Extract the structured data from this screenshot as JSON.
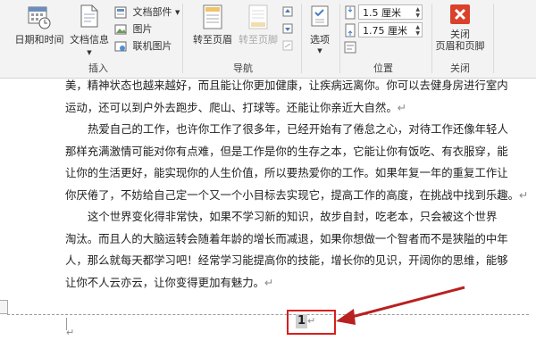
{
  "ribbon": {
    "insert_group": {
      "label": "插入",
      "date_time_label": "日期和时间",
      "doc_info_label": "文档信息",
      "doc_parts_label": "文档部件",
      "picture_label": "图片",
      "online_picture_label": "联机图片"
    },
    "nav_group": {
      "label": "导航",
      "goto_header_label": "转至页眉",
      "goto_footer_label": "转至页脚"
    },
    "options_group": {
      "options_label": "选项"
    },
    "position_group": {
      "label": "位置",
      "header_from_top": "1.5 厘米",
      "footer_from_bottom": "1.75 厘米"
    },
    "close_group": {
      "label": "关闭",
      "close_button_label_line1": "关闭",
      "close_button_label_line2": "页眉和页脚"
    }
  },
  "colors": {
    "accent_red": "#d61f1f",
    "close_icon_red": "#d9412b"
  },
  "document": {
    "lines": [
      "美，精神状态也越来越好，而且能让你更加健康，让疾病远离你。你可以去健身房进行室内",
      "运动，还可以到户外去跑步、爬山、打球等。还能让你亲近大自然。",
      "热爱自己的工作，也许你工作了很多年，已经开始有了倦怠之心，对待工作还像年轻人",
      "那样充满激情可能对你有点难，但是工作是你的生存之本，它能让你有饭吃、有衣服穿，能",
      "让你的生活更好，能实现你的人生价值，所以要热爱你的工作。如果年复一年的重复工作让",
      "你厌倦了，不妨给自己定一个又一个小目标去实现它，提高工作的高度，在挑战中找到乐趣。",
      "这个世界变化得非常快，如果不学习新的知识，故步自封，吃老本，只会被这个世界",
      "淘汰。而且人的大脑运转会随着年龄的增长而减退，如果你想做一个智者而不是狭隘的中年",
      "人，那么就每天都学习吧！经常学习能提高你的技能，增长你的见识，开阔你的思维，能够",
      "让你不人云亦云，让你变得更加有魅力。"
    ],
    "footer_page_number": "1"
  }
}
